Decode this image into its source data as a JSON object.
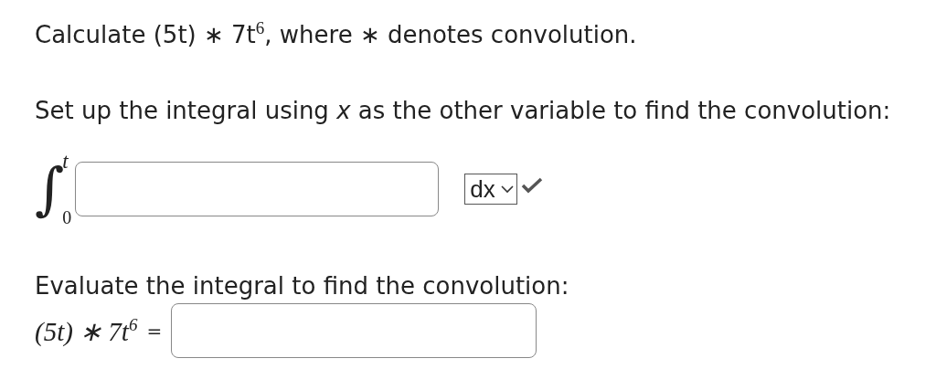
{
  "question": {
    "text": "Calculate (5t) ∗ 7t$^{6}$, where ∗ denotes convolution."
  },
  "setup": {
    "prompt": "Set up the integral using *x* as the other variable to find the convolution:",
    "integral": {
      "sign": "∫",
      "upper": "t",
      "lower": "0"
    },
    "differential": {
      "value": "dx"
    },
    "correct": true
  },
  "evaluate": {
    "prompt": "Evaluate the integral to find the convolution:",
    "lhs": "(5t) ∗ 7t$^{6}$",
    "equals": "="
  }
}
